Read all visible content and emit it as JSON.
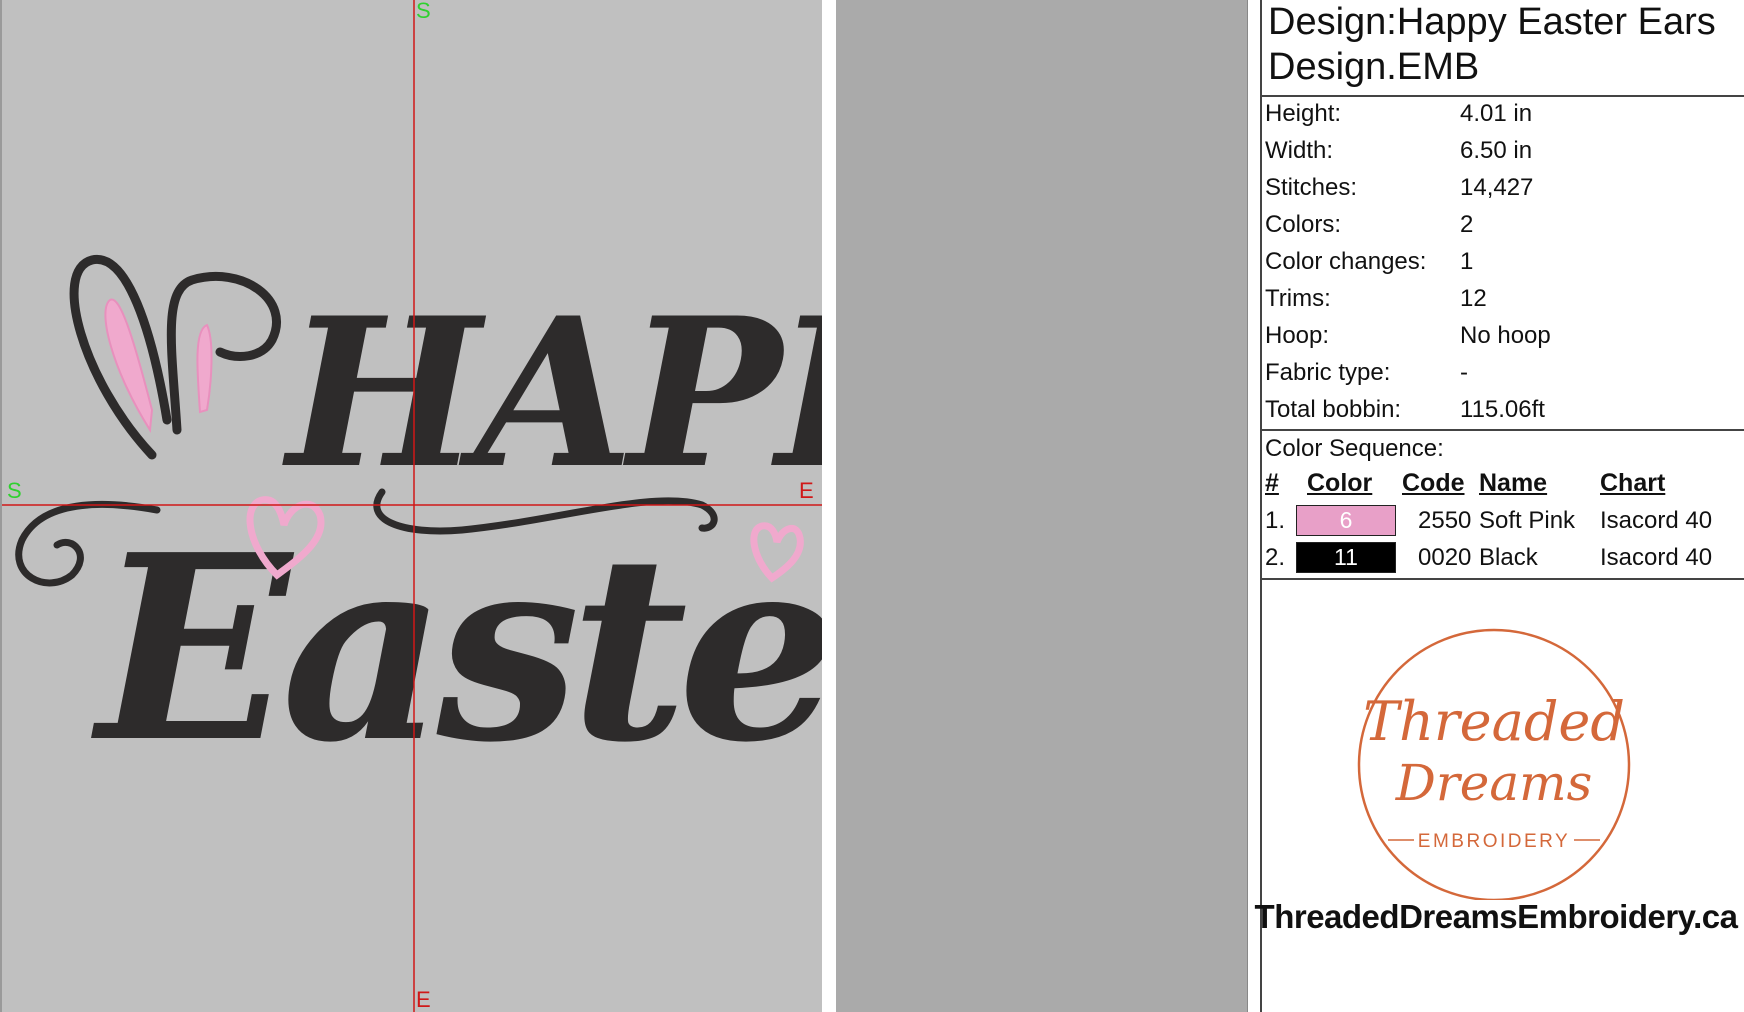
{
  "canvas": {
    "markers": {
      "top": "S",
      "bottom": "E",
      "left": "S",
      "right": "E"
    },
    "design_text": [
      "Happy",
      "Easter"
    ]
  },
  "design": {
    "title": "Design:Happy Easter Ears Design.EMB",
    "properties": [
      {
        "label": "Height:",
        "value": "4.01 in"
      },
      {
        "label": "Width:",
        "value": "6.50 in"
      },
      {
        "label": "Stitches:",
        "value": "14,427"
      },
      {
        "label": "Colors:",
        "value": "2"
      },
      {
        "label": "Color changes:",
        "value": "1"
      },
      {
        "label": "Trims:",
        "value": "12"
      },
      {
        "label": "Hoop:",
        "value": "No hoop"
      },
      {
        "label": "Fabric type:",
        "value": "-"
      },
      {
        "label": "Total bobbin:",
        "value": "115.06ft"
      }
    ]
  },
  "color_sequence": {
    "title": "Color Sequence:",
    "headers": {
      "num": "#",
      "color": "Color",
      "code": "Code",
      "name": "Name",
      "chart": "Chart"
    },
    "rows": [
      {
        "num": "1.",
        "color_number": "6",
        "swatch": "#e8a0c8",
        "text_color": "#ffffff",
        "code": "2550",
        "name": "Soft Pink",
        "chart": "Isacord 40"
      },
      {
        "num": "2.",
        "color_number": "11",
        "swatch": "#000000",
        "text_color": "#ffffff",
        "code": "0020",
        "name": "Black",
        "chart": "Isacord 40"
      }
    ]
  },
  "branding": {
    "logo_text": {
      "line1": "Threaded",
      "line2": "Dreams",
      "line3": "EMBROIDERY"
    },
    "website": "ThreadedDreamsEmbroidery.ca",
    "ring_color": "#d4683a"
  },
  "colors": {
    "canvas_bg": "#c0c0c0",
    "gray_pane": "#aaaaaa",
    "thread_black": "#2d2b2b",
    "thread_pink": "#f0a9cd",
    "crosshair": "#d01818",
    "marker_green": "#2fd12f"
  }
}
